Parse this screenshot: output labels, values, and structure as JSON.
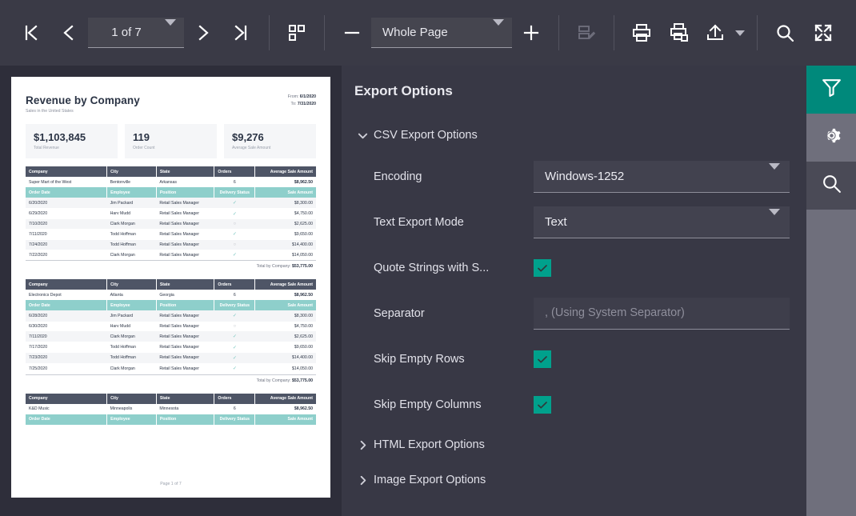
{
  "toolbar": {
    "first_page_icon": "first-page-icon",
    "prev_page_icon": "previous-page-icon",
    "page_value": "1 of 7",
    "next_page_icon": "next-page-icon",
    "last_page_icon": "last-page-icon",
    "multipage_icon": "page-layout-icon",
    "zoom_out_icon": "zoom-out-icon",
    "zoom_value": "Whole Page",
    "zoom_in_icon": "zoom-in-icon",
    "edit_icon": "edit-fields-icon",
    "print_icon": "print-icon",
    "print_current_icon": "print-current-page-icon",
    "export_icon": "export-upload-icon",
    "export_caret_icon": "chevron-down-icon",
    "search_icon": "search-icon",
    "fullscreen_icon": "fullscreen-icon",
    "accent": "#00a18c",
    "background": "#3a3a46"
  },
  "panel": {
    "title": "Export Options",
    "groups": [
      {
        "label": "CSV Export Options",
        "expanded": true,
        "chevron": "chevron-down-icon"
      },
      {
        "label": "HTML Export Options",
        "expanded": false,
        "chevron": "chevron-right-icon"
      },
      {
        "label": "Image Export Options",
        "expanded": false,
        "chevron": "chevron-right-icon"
      }
    ],
    "options": [
      {
        "label": "Encoding",
        "type": "select",
        "value": "Windows-1252"
      },
      {
        "label": "Text Export Mode",
        "type": "select",
        "value": "Text"
      },
      {
        "label": "Quote Strings with Separators",
        "label_display": "Quote Strings with S...",
        "type": "checkbox",
        "checked": true
      },
      {
        "label": "Separator",
        "type": "text",
        "value": "",
        "placeholder": ", (Using System Separator)"
      },
      {
        "label": "Skip Empty Rows",
        "type": "checkbox",
        "checked": true
      },
      {
        "label": "Skip Empty Columns",
        "type": "checkbox",
        "checked": true
      }
    ]
  },
  "rail": {
    "items": [
      {
        "name": "filter-icon",
        "label": "Filter",
        "state": "active"
      },
      {
        "name": "gear-icon",
        "label": "Settings",
        "state": "hover"
      },
      {
        "name": "search-icon",
        "label": "Search",
        "state": "normal"
      }
    ],
    "active_color": "#00897b",
    "hover_color": "#6f6f7c"
  },
  "document": {
    "title": "Revenue by Company",
    "subtitle": "Sales in the United States",
    "date_from_label": "From:",
    "date_from_value": "6/1/2020",
    "date_to_label": "To:",
    "date_to_value": "7/31/2020",
    "kpis": [
      {
        "value": "$1,103,845",
        "label": "Total Revenue"
      },
      {
        "value": "119",
        "label": "Order Count"
      },
      {
        "value": "$9,276",
        "label": "Average Sale Amount"
      }
    ],
    "company_columns": [
      "Company",
      "City",
      "State",
      "Orders",
      "Average Sale Amount"
    ],
    "detail_columns": [
      "Order Date",
      "Employee",
      "Position",
      "Delivery Status",
      "Sale Amount"
    ],
    "total_label": "Total by Company:",
    "footer": "Page 1 of 7",
    "blocks": [
      {
        "company": "Super Mart of the West",
        "city": "Bentonville",
        "state": "Arkansas",
        "orders": "6",
        "avg": "$8,962.50",
        "total": "$53,775.00",
        "rows": [
          {
            "date": "6/20/2020",
            "employee": "Jim Packard",
            "position": "Retail Sales Manager",
            "status": "check",
            "amount": "$8,300.00"
          },
          {
            "date": "6/29/2020",
            "employee": "Harv Mudd",
            "position": "Retail Sales Manager",
            "status": "check",
            "amount": "$4,750.00"
          },
          {
            "date": "7/10/2020",
            "employee": "Clark Morgan",
            "position": "Retail Sales Manager",
            "status": "pending",
            "amount": "$2,625.00"
          },
          {
            "date": "7/11/2020",
            "employee": "Todd Hoffman",
            "position": "Retail Sales Manager",
            "status": "check",
            "amount": "$9,650.00"
          },
          {
            "date": "7/24/2020",
            "employee": "Todd Hoffman",
            "position": "Retail Sales Manager",
            "status": "clock",
            "amount": "$14,400.00"
          },
          {
            "date": "7/22/2020",
            "employee": "Clark Morgan",
            "position": "Retail Sales Manager",
            "status": "check",
            "amount": "$14,050.00"
          }
        ]
      },
      {
        "company": "Electronics Depot",
        "city": "Atlanta",
        "state": "Georgia",
        "orders": "6",
        "avg": "$8,962.50",
        "total": "$53,775.00",
        "rows": [
          {
            "date": "6/28/2020",
            "employee": "Jim Packard",
            "position": "Retail Sales Manager",
            "status": "check",
            "amount": "$8,300.00"
          },
          {
            "date": "6/30/2020",
            "employee": "Harv Mudd",
            "position": "Retail Sales Manager",
            "status": "clock",
            "amount": "$4,750.00"
          },
          {
            "date": "7/11/2020",
            "employee": "Clark Morgan",
            "position": "Retail Sales Manager",
            "status": "check",
            "amount": "$2,625.00"
          },
          {
            "date": "7/17/2020",
            "employee": "Todd Hoffman",
            "position": "Retail Sales Manager",
            "status": "check",
            "amount": "$9,650.00"
          },
          {
            "date": "7/23/2020",
            "employee": "Todd Hoffman",
            "position": "Retail Sales Manager",
            "status": "check",
            "amount": "$14,400.00"
          },
          {
            "date": "7/25/2020",
            "employee": "Clark Morgan",
            "position": "Retail Sales Manager",
            "status": "check",
            "amount": "$14,050.00"
          }
        ]
      },
      {
        "company": "K&D Music",
        "city": "Minneapolis",
        "state": "Minnesota",
        "orders": "6",
        "avg": "$8,962.50",
        "total": "",
        "rows": []
      }
    ]
  }
}
